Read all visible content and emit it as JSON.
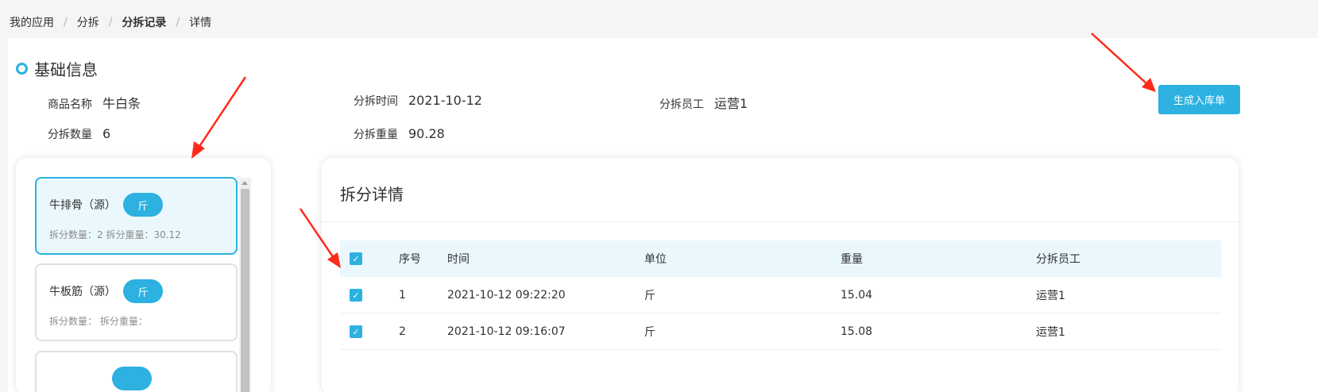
{
  "breadcrumb": [
    "我的应用",
    "分拆",
    "分拆记录",
    "详情"
  ],
  "breadcrumb_sep": "/",
  "section_title": "基础信息",
  "info": {
    "product_label": "商品名称",
    "product_value": "牛白条",
    "time_label": "分拆时间",
    "time_value": "2021-10-12",
    "staff_label": "分拆员工",
    "staff_value": "运营1",
    "qty_label": "分拆数量",
    "qty_value": "6",
    "weight_label": "分拆重量",
    "weight_value": "90.28"
  },
  "generate_button": "生成入库单",
  "items": [
    {
      "name": "牛排骨（源）",
      "unit": "斤",
      "meta": "拆分数量：2 拆分重量：30.12"
    },
    {
      "name": "牛板筋（源）",
      "unit": "斤",
      "meta": "拆分数量：  拆分重量："
    }
  ],
  "detail_title": "拆分详情",
  "table": {
    "columns": [
      "序号",
      "时间",
      "单位",
      "重量",
      "分拆员工"
    ],
    "rows": [
      {
        "index": "1",
        "time": "2021-10-12 09:22:20",
        "unit": "斤",
        "weight": "15.04",
        "staff": "运营1"
      },
      {
        "index": "2",
        "time": "2021-10-12 09:16:07",
        "unit": "斤",
        "weight": "15.08",
        "staff": "运营1"
      }
    ]
  },
  "colors": {
    "accent": "#2cb1e1",
    "arrow": "#ff2a1a"
  },
  "checkbox_glyph": "✓"
}
